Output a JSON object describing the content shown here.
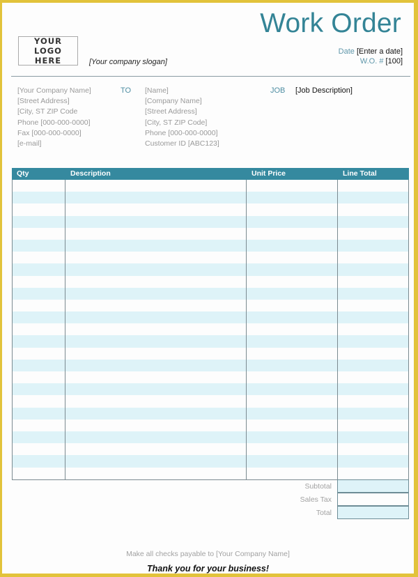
{
  "colors": {
    "accent": "#348496",
    "frame": "#e2c33b",
    "table_header_bg": "#35899f",
    "row_alt_bg": "#def3f8"
  },
  "header": {
    "title": "Work Order",
    "logo_text_line1": "YOUR LOGO",
    "logo_text_line2": "HERE",
    "slogan": "[Your company slogan]",
    "date_label": "Date",
    "date_value": "[Enter a date]",
    "wo_label": "W.O. #",
    "wo_value": "[100]"
  },
  "from": {
    "lines": [
      "[Your Company Name]",
      "[Street Address]",
      "[City, ST  ZIP Code",
      "Phone [000-000-0000]",
      "Fax [000-000-0000]",
      "[e-mail]"
    ]
  },
  "to": {
    "label": "TO",
    "lines": [
      "[Name]",
      "[Company Name]",
      "[Street Address]",
      "[City, ST  ZIP Code]",
      "Phone [000-000-0000]",
      "Customer ID [ABC123]"
    ]
  },
  "job": {
    "label": "JOB",
    "description": "[Job Description]"
  },
  "table": {
    "columns": [
      "Qty",
      "Description",
      "Unit Price",
      "Line Total"
    ],
    "row_count": 25
  },
  "totals": {
    "subtotal_label": "Subtotal",
    "sales_tax_label": "Sales Tax",
    "total_label": "Total"
  },
  "footer": {
    "checks_note": "Make all checks payable to [Your Company Name]",
    "thanks": "Thank you for your business!"
  }
}
